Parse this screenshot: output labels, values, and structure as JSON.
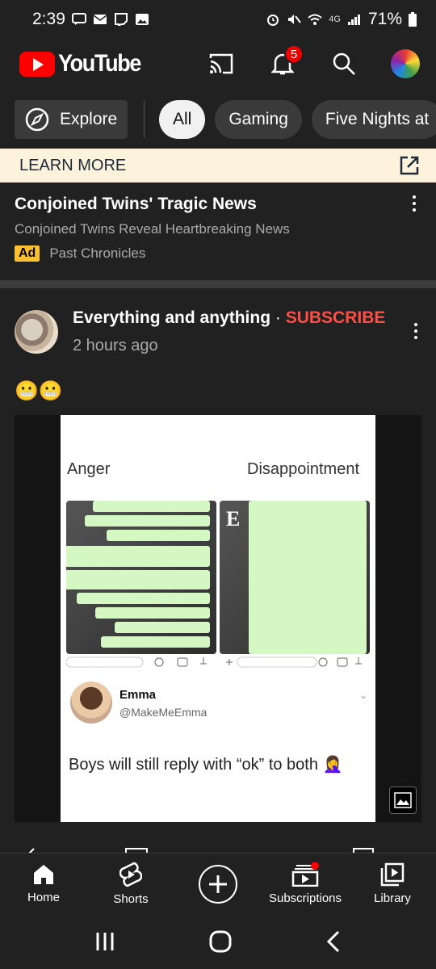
{
  "status_bar": {
    "time": "2:39",
    "network": "4G",
    "battery": "71%"
  },
  "app_bar": {
    "logo_text": "YouTube",
    "notification_count": "5"
  },
  "chips": {
    "explore": "Explore",
    "items": [
      "All",
      "Gaming",
      "Five Nights at"
    ]
  },
  "ad": {
    "cta": "LEARN MORE",
    "title": "Conjoined Twins' Tragic News",
    "subtitle": "Conjoined Twins Reveal Heartbreaking News",
    "badge": "Ad",
    "advertiser": "Past Chronicles"
  },
  "post": {
    "channel": "Everything and anything",
    "separator": " · ",
    "subscribe": "SUBSCRIBE",
    "time": "2 hours ago",
    "text": "😬😬",
    "image": {
      "label_left": "Anger",
      "label_right": "Disappointment",
      "tweet_name": "Emma",
      "tweet_handle": "@MakeMeEmma",
      "tweet_text": "Boys will still reply with “ok” to both 🤦‍♀️"
    }
  },
  "bottom_nav": {
    "items": [
      {
        "label": "Home",
        "icon": "home-icon"
      },
      {
        "label": "Shorts",
        "icon": "shorts-icon"
      },
      {
        "label": "",
        "icon": "create-icon"
      },
      {
        "label": "Subscriptions",
        "icon": "subscriptions-icon"
      },
      {
        "label": "Library",
        "icon": "library-icon"
      }
    ]
  },
  "colors": {
    "background": "#212121",
    "accent_red": "#ff0000",
    "subscribe_red": "#ff4e45",
    "ad_banner": "#fdf3dd",
    "ad_badge": "#fbc02d"
  }
}
